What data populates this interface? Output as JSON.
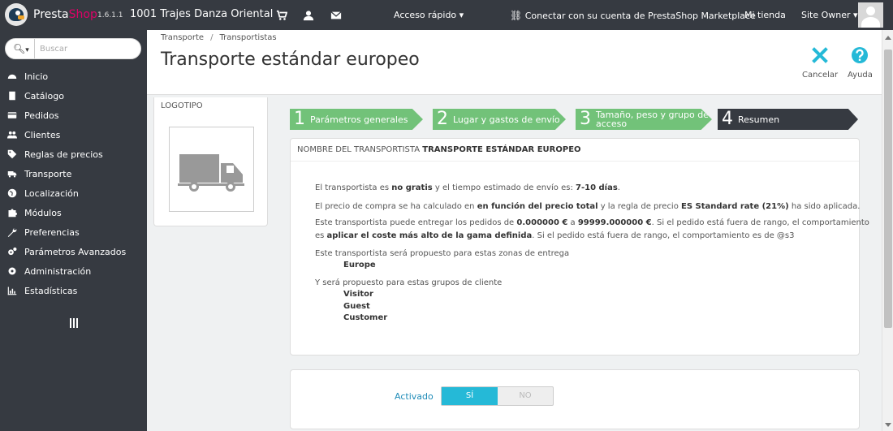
{
  "header": {
    "brand_presta": "Presta",
    "brand_shop": "Shop",
    "version": "1.6.1.1",
    "shop_name": "1001 Trajes Danza Oriental",
    "quick_access": "Acceso rápido",
    "marketplace": "Conectar con su cuenta de PrestaShop Marketplace",
    "my_shop": "Mi tienda",
    "user": "Site Owner"
  },
  "sidebar": {
    "search_placeholder": "Buscar",
    "items": [
      {
        "label": "Inicio",
        "icon": "dashboard-icon"
      },
      {
        "label": "Catálogo",
        "icon": "book-icon"
      },
      {
        "label": "Pedidos",
        "icon": "credit-card-icon"
      },
      {
        "label": "Clientes",
        "icon": "users-icon"
      },
      {
        "label": "Reglas de precios",
        "icon": "tag-icon"
      },
      {
        "label": "Transporte",
        "icon": "truck-icon"
      },
      {
        "label": "Localización",
        "icon": "globe-icon"
      },
      {
        "label": "Módulos",
        "icon": "puzzle-icon"
      },
      {
        "label": "Preferencias",
        "icon": "wrench-icon"
      },
      {
        "label": "Parámetros Avanzados",
        "icon": "cogs-icon"
      },
      {
        "label": "Administración",
        "icon": "cog-icon"
      },
      {
        "label": "Estadísticas",
        "icon": "bar-chart-icon"
      }
    ]
  },
  "page": {
    "breadcrumb": [
      "Transporte",
      "Transportistas"
    ],
    "title": "Transporte estándar europeo",
    "cancel_label": "Cancelar",
    "help_label": "Ayuda"
  },
  "logo_panel": {
    "label": "LOGOTIPO"
  },
  "steps": [
    {
      "num": "1",
      "label": "Parámetros generales"
    },
    {
      "num": "2",
      "label": "Lugar y gastos de envío"
    },
    {
      "num": "3",
      "label_line1": "Tamaño, peso y grupo de",
      "label_line2": "acceso"
    },
    {
      "num": "4",
      "label": "Resumen"
    }
  ],
  "summary": {
    "head_prefix": "NOMBRE DEL TRANSPORTISTA",
    "carrier_name": "TRANSPORTE ESTÁNDAR EUROPEO",
    "l1_a": "El transportista es ",
    "l1_b": "no gratis",
    "l1_c": " y el tiempo estimado de envío es: ",
    "l1_d": "7-10 días",
    "l1_e": ".",
    "l2_a": "El precio de compra se ha calculado en ",
    "l2_b": "en función del precio total",
    "l2_c": " y la regla de precio ",
    "l2_d": "ES Standard rate (21%)",
    "l2_e": " ha sido aplicada.",
    "l3_a": "Este transportista puede entregar los pedidos de ",
    "l3_b": "0.000000 €",
    "l3_c": " a ",
    "l3_d": "99999.000000 €",
    "l3_e": ". Si el pedido está fuera de rango, el comportamiento",
    "l4_a": "es ",
    "l4_b": "aplicar el coste más alto de la gama definida",
    "l4_c": ". Si el pedido está fuera de rango, el comportamiento es de @s3",
    "zones_intro": "Este transportista será propuesto para estas zonas de entrega",
    "zones": [
      "Europe"
    ],
    "groups_intro": "Y será propuesto para estas grupos de cliente",
    "groups": [
      "Visitor",
      "Guest",
      "Customer"
    ]
  },
  "active": {
    "label": "Activado",
    "yes": "SÍ",
    "no": "NO",
    "value": true
  }
}
